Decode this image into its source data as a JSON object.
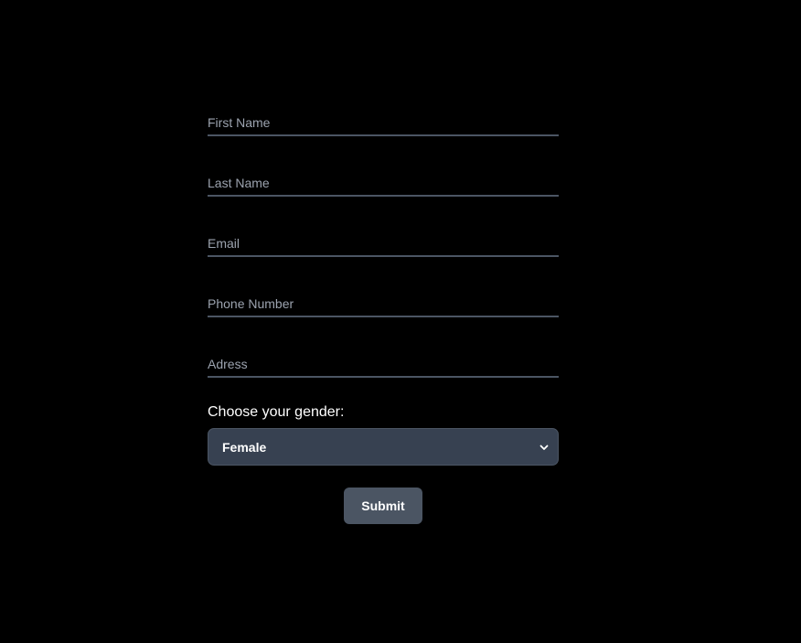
{
  "form": {
    "fields": [
      {
        "name": "first-name",
        "placeholder": "First Name",
        "value": ""
      },
      {
        "name": "last-name",
        "placeholder": "Last Name",
        "value": ""
      },
      {
        "name": "email",
        "placeholder": "Email",
        "value": ""
      },
      {
        "name": "phone",
        "placeholder": "Phone Number",
        "value": ""
      },
      {
        "name": "address",
        "placeholder": "Adress",
        "value": ""
      }
    ],
    "gender_label": "Choose your gender:",
    "gender_selected": "Female",
    "submit_label": "Submit"
  },
  "colors": {
    "background": "#000000",
    "field_border": "#4b5563",
    "placeholder": "#9ca3af",
    "select_bg": "#374151",
    "button_bg": "#4b5563"
  },
  "icons": {
    "select_chevron": "chevron-down-icon"
  }
}
